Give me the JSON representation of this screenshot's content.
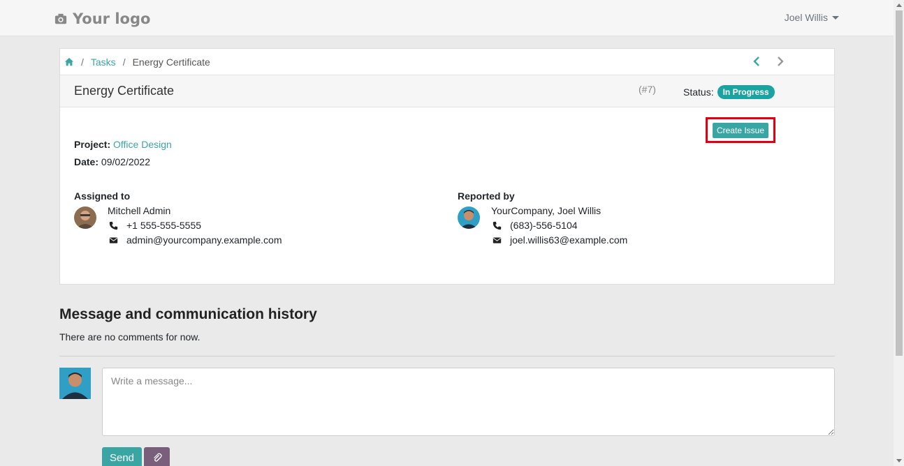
{
  "header": {
    "logo_text": "Your logo",
    "user_name": "Joel Willis"
  },
  "breadcrumb": {
    "items": [
      "Tasks",
      "Energy Certificate"
    ],
    "separator": "/"
  },
  "task": {
    "title": "Energy Certificate",
    "id": "(#7)",
    "status_label": "Status:",
    "status_value": "In Progress",
    "create_issue_label": "Create Issue",
    "project_label": "Project:",
    "project_value": "Office Design",
    "date_label": "Date:",
    "date_value": "09/02/2022"
  },
  "assigned": {
    "label": "Assigned to",
    "name": "Mitchell Admin",
    "phone": "+1 555-555-5555",
    "email": "admin@yourcompany.example.com"
  },
  "reported": {
    "label": "Reported by",
    "name": "YourCompany, Joel Willis",
    "phone": "(683)-556-5104",
    "email": "joel.willis63@example.com"
  },
  "history": {
    "title": "Message and communication history",
    "empty_text": "There are no comments for now.",
    "placeholder": "Write a message...",
    "send_label": "Send"
  },
  "colors": {
    "accent": "#3aa6a4",
    "badge": "#1aa3a1",
    "highlight": "#e0000f",
    "attach_button": "#7a5f7d"
  }
}
